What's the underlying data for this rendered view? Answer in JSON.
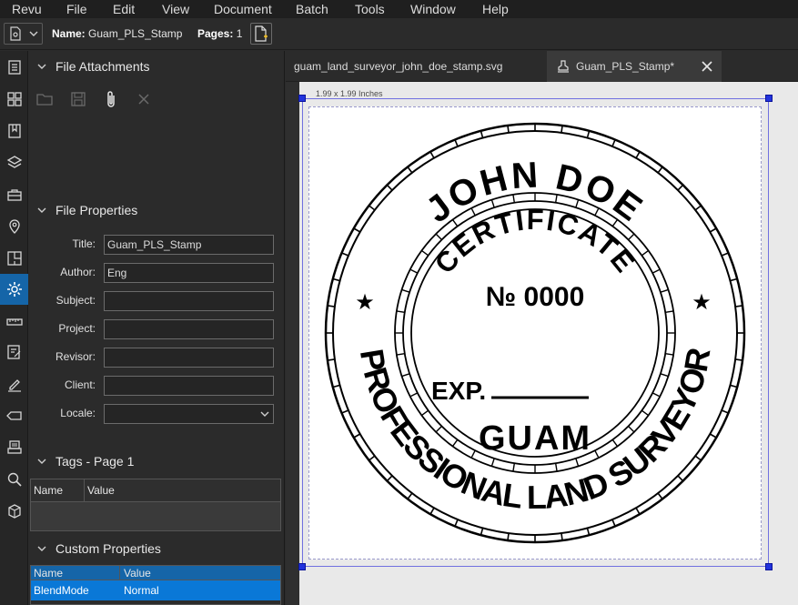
{
  "menu": [
    "Revu",
    "File",
    "Edit",
    "View",
    "Document",
    "Batch",
    "Tools",
    "Window",
    "Help"
  ],
  "toolbar": {
    "name_label": "Name:",
    "name_value": "Guam_PLS_Stamp",
    "pages_label": "Pages:",
    "pages_value": "1"
  },
  "panel": {
    "attachments_title": "File Attachments",
    "file_properties_title": "File Properties",
    "properties": [
      {
        "label": "Title:",
        "value": "Guam_PLS_Stamp"
      },
      {
        "label": "Author:",
        "value": "Eng"
      },
      {
        "label": "Subject:",
        "value": ""
      },
      {
        "label": "Project:",
        "value": ""
      },
      {
        "label": "Revisor:",
        "value": ""
      },
      {
        "label": "Client:",
        "value": ""
      },
      {
        "label": "Locale:",
        "value": ""
      }
    ],
    "tags_title": "Tags - Page 1",
    "tags_columns": [
      "Name",
      "Value"
    ],
    "custom_title": "Custom Properties",
    "custom_columns": [
      "Name",
      "Value"
    ],
    "custom_rows": [
      {
        "name": "BlendMode",
        "value": "Normal"
      }
    ]
  },
  "tabs": [
    {
      "label": "guam_land_surveyor_john_doe_stamp.svg",
      "active": false
    },
    {
      "label": "Guam_PLS_Stamp*",
      "active": true
    }
  ],
  "canvas": {
    "size_label": "1.99 x 1.99 Inches"
  },
  "stamp": {
    "top_name": "JOHN DOE",
    "certificate": "CERTIFICATE",
    "number": "№ 0000",
    "exp": "EXP.",
    "territory": "GUAM",
    "bottom_text": "PROFESSIONAL LAND SURVEYOR",
    "star": "★"
  },
  "colors": {
    "accent": "#1565a8",
    "selection_handle": "#2233dd",
    "row_selected": "#0a78d7"
  }
}
